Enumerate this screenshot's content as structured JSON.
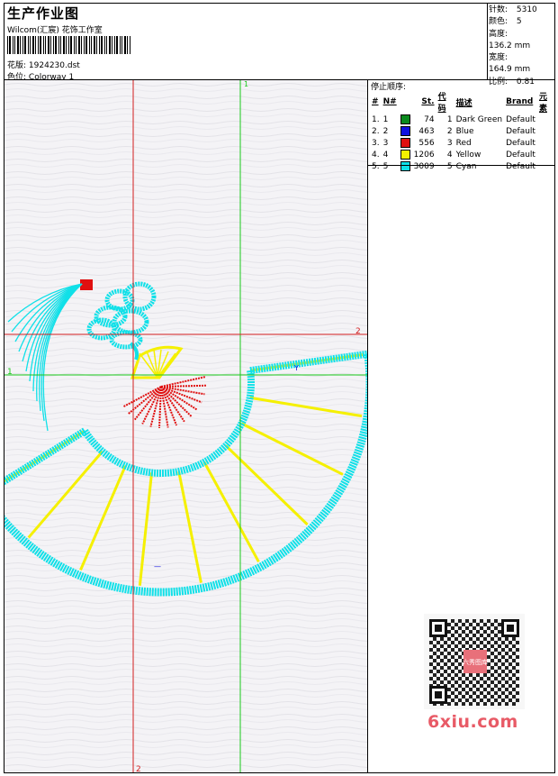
{
  "header": {
    "title": "生产作业图",
    "company": "Wilcom(汇宸) 花饰工作室",
    "design_label": "花版:",
    "design_value": "1924230.dst",
    "colorway_label": "色位:",
    "colorway_value": "Colorway 1"
  },
  "stats": [
    {
      "label": "针数:",
      "value": "5310"
    },
    {
      "label": "颜色:",
      "value": "5"
    },
    {
      "label": "高度:",
      "value": "136.2 mm"
    },
    {
      "label": "宽度:",
      "value": "164.9 mm"
    },
    {
      "label": "比例:",
      "value": "0.81"
    }
  ],
  "stop_sequence": {
    "title": "停止顺序:",
    "headers": [
      "#",
      "N#",
      "St.",
      "代码",
      "描述",
      "Brand",
      "元素"
    ],
    "rows": [
      {
        "num": "1.",
        "n": "1",
        "color": "#0a8a1e",
        "stitches": "74",
        "code": "1",
        "desc": "Dark Green",
        "brand": "Default"
      },
      {
        "num": "2.",
        "n": "2",
        "color": "#1010e0",
        "stitches": "463",
        "code": "2",
        "desc": "Blue",
        "brand": "Default"
      },
      {
        "num": "3.",
        "n": "3",
        "color": "#e01010",
        "stitches": "556",
        "code": "3",
        "desc": "Red",
        "brand": "Default"
      },
      {
        "num": "4.",
        "n": "4",
        "color": "#f5f000",
        "stitches": "1206",
        "code": "4",
        "desc": "Yellow",
        "brand": "Default"
      },
      {
        "num": "5.",
        "n": "5",
        "color": "#10e0e8",
        "stitches": "3009",
        "code": "5",
        "desc": "Cyan",
        "brand": "Default"
      }
    ]
  },
  "canvas": {
    "guide_labels": {
      "v1": "1",
      "v2": "2",
      "h1": "1",
      "h2": "2"
    },
    "guide_colors": {
      "green": "#19c819",
      "red": "#d21e1e"
    }
  },
  "watermark": {
    "site": "6xiu.com",
    "stamp": "六秀图库"
  }
}
